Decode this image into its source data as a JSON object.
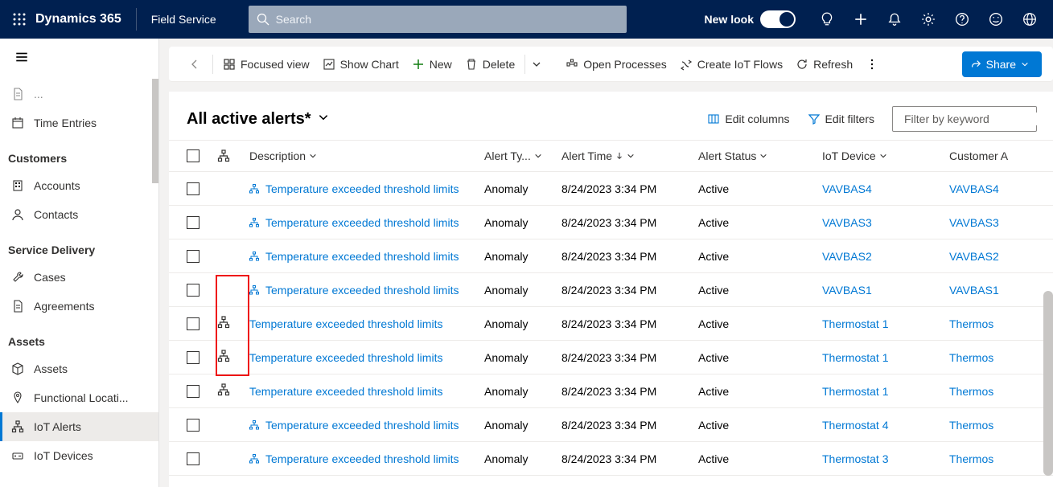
{
  "topbar": {
    "brand": "Dynamics 365",
    "module": "Field Service",
    "search_placeholder": "Search",
    "newlook_label": "New look"
  },
  "sidebar": {
    "items_top": [
      {
        "label": "",
        "icon": "requests"
      },
      {
        "label": "Time Entries",
        "icon": "calendar"
      }
    ],
    "section_customers": "Customers",
    "customers": [
      {
        "label": "Accounts",
        "icon": "building"
      },
      {
        "label": "Contacts",
        "icon": "person"
      }
    ],
    "section_service": "Service Delivery",
    "service": [
      {
        "label": "Cases",
        "icon": "wrench"
      },
      {
        "label": "Agreements",
        "icon": "document"
      }
    ],
    "section_assets": "Assets",
    "assets": [
      {
        "label": "Assets",
        "icon": "cube"
      },
      {
        "label": "Functional Locati...",
        "icon": "pin"
      },
      {
        "label": "IoT Alerts",
        "icon": "hierarchy",
        "active": true
      },
      {
        "label": "IoT Devices",
        "icon": "device"
      }
    ]
  },
  "commandbar": {
    "focused_view": "Focused view",
    "show_chart": "Show Chart",
    "new": "New",
    "delete": "Delete",
    "open_processes": "Open Processes",
    "create_iot_flows": "Create IoT Flows",
    "refresh": "Refresh",
    "share": "Share"
  },
  "view": {
    "title": "All active alerts*",
    "edit_columns": "Edit columns",
    "edit_filters": "Edit filters",
    "filter_placeholder": "Filter by keyword"
  },
  "columns": {
    "description": "Description",
    "alert_type": "Alert Ty...",
    "alert_time": "Alert Time",
    "alert_status": "Alert Status",
    "iot_device": "IoT Device",
    "customer": "Customer A"
  },
  "rows": [
    {
      "desc": "Temperature exceeded threshold limits",
      "type": "Anomaly",
      "time": "8/24/2023 3:34 PM",
      "status": "Active",
      "device": "VAVBAS4",
      "cust": "VAVBAS4",
      "hier": false,
      "desc_icon": true
    },
    {
      "desc": "Temperature exceeded threshold limits",
      "type": "Anomaly",
      "time": "8/24/2023 3:34 PM",
      "status": "Active",
      "device": "VAVBAS3",
      "cust": "VAVBAS3",
      "hier": false,
      "desc_icon": true
    },
    {
      "desc": "Temperature exceeded threshold limits",
      "type": "Anomaly",
      "time": "8/24/2023 3:34 PM",
      "status": "Active",
      "device": "VAVBAS2",
      "cust": "VAVBAS2",
      "hier": false,
      "desc_icon": true
    },
    {
      "desc": "Temperature exceeded threshold limits",
      "type": "Anomaly",
      "time": "8/24/2023 3:34 PM",
      "status": "Active",
      "device": "VAVBAS1",
      "cust": "VAVBAS1",
      "hier": false,
      "desc_icon": true
    },
    {
      "desc": "Temperature exceeded threshold limits",
      "type": "Anomaly",
      "time": "8/24/2023 3:34 PM",
      "status": "Active",
      "device": "Thermostat 1",
      "cust": "Thermos",
      "hier": true,
      "desc_icon": false
    },
    {
      "desc": "Temperature exceeded threshold limits",
      "type": "Anomaly",
      "time": "8/24/2023 3:34 PM",
      "status": "Active",
      "device": "Thermostat 1",
      "cust": "Thermos",
      "hier": true,
      "desc_icon": false
    },
    {
      "desc": "Temperature exceeded threshold limits",
      "type": "Anomaly",
      "time": "8/24/2023 3:34 PM",
      "status": "Active",
      "device": "Thermostat 1",
      "cust": "Thermos",
      "hier": true,
      "desc_icon": false
    },
    {
      "desc": "Temperature exceeded threshold limits",
      "type": "Anomaly",
      "time": "8/24/2023 3:34 PM",
      "status": "Active",
      "device": "Thermostat 4",
      "cust": "Thermos",
      "hier": false,
      "desc_icon": true
    },
    {
      "desc": "Temperature exceeded threshold limits",
      "type": "Anomaly",
      "time": "8/24/2023 3:34 PM",
      "status": "Active",
      "device": "Thermostat 3",
      "cust": "Thermos",
      "hier": false,
      "desc_icon": true
    }
  ]
}
